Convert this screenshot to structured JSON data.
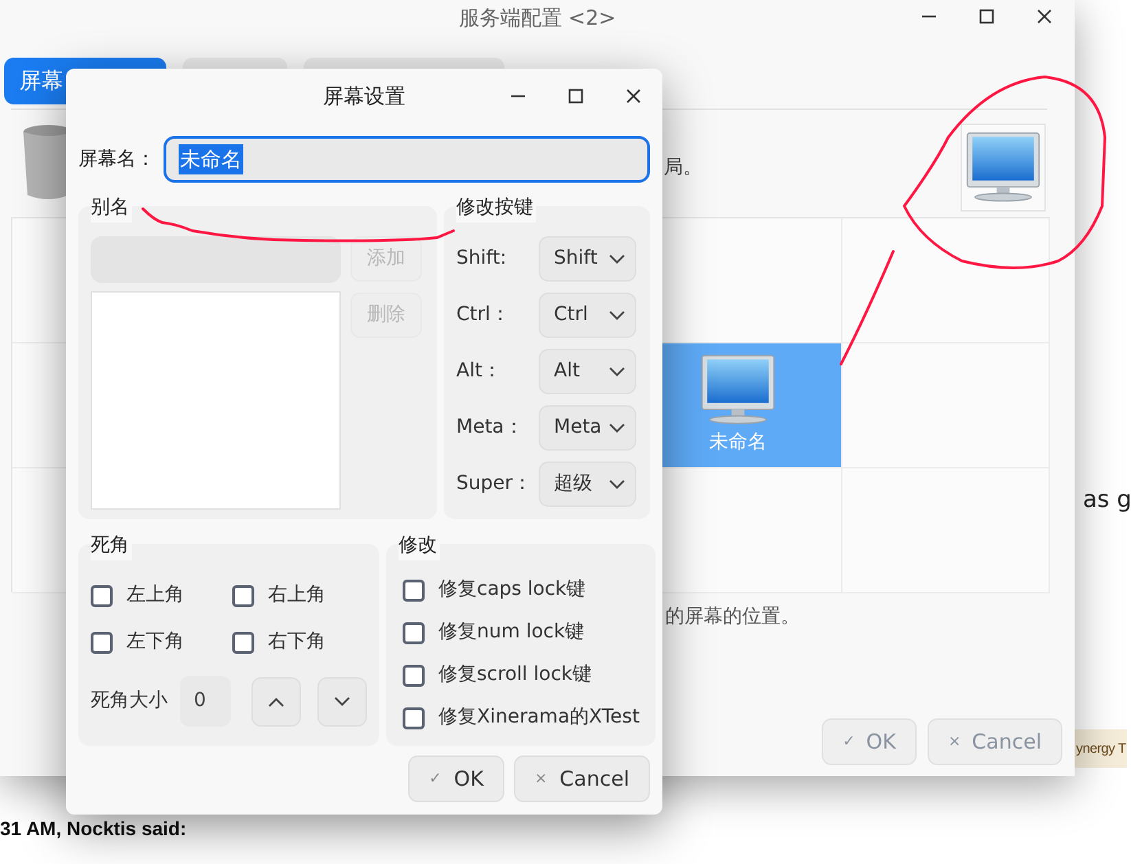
{
  "background_page": {
    "snippet": "as g",
    "tag": "ynergy T",
    "chat_line": "31 AM, Nocktis said:"
  },
  "main_window": {
    "title": "服务端配置 <2>",
    "tabs": [
      {
        "label": "屏幕",
        "selected": true
      },
      {
        "selected": false
      },
      {
        "selected": false
      }
    ],
    "hint_text": "局。",
    "selected_screen": {
      "name": "未命名",
      "selected": true
    },
    "position_hint": "的屏幕的位置。",
    "buttons": [
      {
        "icon": "✓",
        "label": "OK",
        "disabled": true
      },
      {
        "icon": "×",
        "label": "Cancel",
        "disabled": true
      }
    ]
  },
  "dialog": {
    "title": "屏幕设置",
    "screen_name": {
      "label": "屏幕名：",
      "value": "未命名",
      "text_selected": true
    },
    "aliases": {
      "title": "别名",
      "input_disabled": true,
      "buttons": [
        {
          "label": "添加",
          "disabled": true
        },
        {
          "label": "删除",
          "disabled": true
        }
      ]
    },
    "modifier_keys": {
      "title": "修改按键",
      "rows": [
        {
          "label": "Shift:",
          "value": "Shift"
        },
        {
          "label": "Ctrl：",
          "value": "Ctrl"
        },
        {
          "label": "Alt：",
          "value": "Alt"
        },
        {
          "label": "Meta：",
          "value": "Meta"
        },
        {
          "label": "Super：",
          "value": "超级"
        }
      ]
    },
    "dead_corners": {
      "title": "死角",
      "corners": [
        {
          "label": "左上角",
          "checked": false
        },
        {
          "label": "右上角",
          "checked": false
        },
        {
          "label": "左下角",
          "checked": false
        },
        {
          "label": "右下角",
          "checked": false
        }
      ],
      "size": {
        "label": "死角大小",
        "value": "0"
      }
    },
    "fixes": {
      "title": "修改",
      "options": [
        {
          "label": "修复caps lock键",
          "checked": false
        },
        {
          "label": "修复num lock键",
          "checked": false
        },
        {
          "label": "修复scroll lock键",
          "checked": false
        },
        {
          "label": "修复Xinerama的XTest",
          "checked": false
        }
      ]
    },
    "buttons": [
      {
        "icon": "✓",
        "label": "OK",
        "disabled": false
      },
      {
        "icon": "×",
        "label": "Cancel",
        "disabled": false
      }
    ]
  }
}
